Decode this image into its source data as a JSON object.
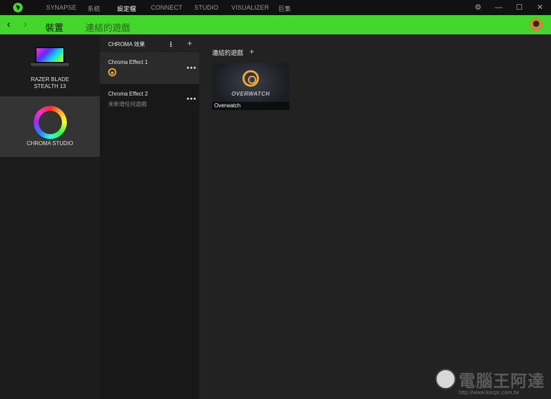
{
  "topbar": {
    "logo_icon": "razer-logo-icon",
    "nav": [
      {
        "label": "SYNAPSE",
        "active": false
      },
      {
        "label": "系統",
        "active": false
      },
      {
        "label": "設定檔",
        "active": true
      },
      {
        "label": "CONNECT",
        "active": false
      },
      {
        "label": "STUDIO",
        "active": false
      },
      {
        "label": "VISUALIZER",
        "active": false
      },
      {
        "label": "巨集",
        "active": false
      }
    ],
    "window_controls": {
      "settings": "⚙",
      "minimize": "—",
      "maximize": "☐",
      "close": "✕"
    }
  },
  "subheader": {
    "back": "‹",
    "forward": "›",
    "title": "裝置",
    "subtitle": "連結的遊戲"
  },
  "devices": [
    {
      "name_line1": "RAZER BLADE",
      "name_line2": "STEALTH 13",
      "icon": "laptop-icon"
    },
    {
      "name": "CHROMA STUDIO",
      "icon": "chroma-ring-icon"
    }
  ],
  "effects": {
    "header": "CHROMA 效果",
    "import_icon": "⭳",
    "add_icon": "+",
    "items": [
      {
        "name": "Chroma Effect 1",
        "game_icon": "overwatch-icon",
        "more": "•••"
      },
      {
        "name": "Chroma Effect 2",
        "subtitle": "未新增任何遊戲",
        "more": "•••"
      }
    ]
  },
  "linked_games": {
    "title": "連結的遊戲",
    "add_icon": "+",
    "games": [
      {
        "name": "Overwatch",
        "art_text": "OVERWATCH"
      }
    ]
  },
  "watermark": {
    "text": "電腦王阿達",
    "url": "http://www.kocpc.com.tw"
  },
  "colors": {
    "accent": "#44d62c",
    "background": "#222222",
    "topbar": "#111111"
  }
}
